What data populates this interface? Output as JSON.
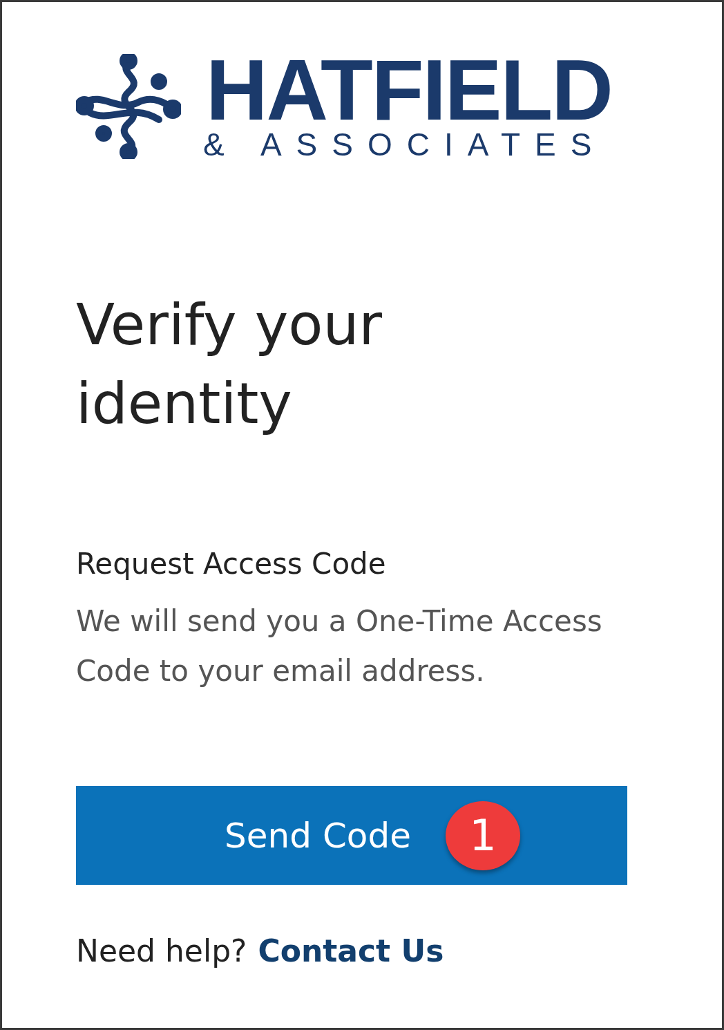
{
  "logo": {
    "name": "HATFIELD",
    "tagline": "& ASSOCIATES"
  },
  "heading": "Verify your identity",
  "section_title": "Request Access Code",
  "description": "We will send you a One-Time Access Code to your email address.",
  "button": {
    "label": "Send Code",
    "badge": "1"
  },
  "help": {
    "text": "Need help?",
    "link": "Contact Us"
  }
}
